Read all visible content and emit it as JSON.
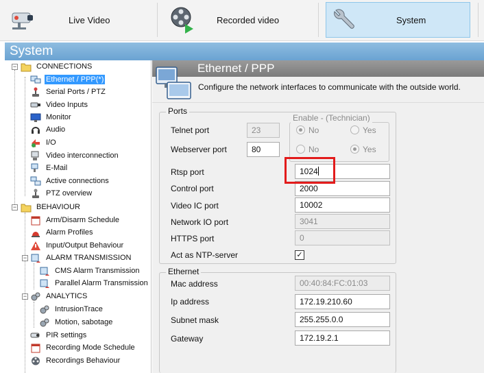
{
  "topbar": {
    "tabs": [
      {
        "label": "Live Video",
        "icon": "security-camera-icon",
        "selected": false
      },
      {
        "label": "Recorded video",
        "icon": "film-reel-play-icon",
        "selected": false
      },
      {
        "label": "System",
        "icon": "wrench-icon",
        "selected": true
      }
    ]
  },
  "system_title": "System",
  "tree": {
    "connections": {
      "label": "CONNECTIONS",
      "items": [
        {
          "label": "Ethernet / PPP(*)",
          "icon": "network-computer-icon",
          "selected": true
        },
        {
          "label": "Serial Ports / PTZ",
          "icon": "joystick-icon"
        },
        {
          "label": "Video Inputs",
          "icon": "camera-icon"
        },
        {
          "label": "Monitor",
          "icon": "monitor-icon"
        },
        {
          "label": "Audio",
          "icon": "headset-icon"
        },
        {
          "label": "I/O",
          "icon": "io-icon"
        },
        {
          "label": "Video interconnection",
          "icon": "video-link-icon"
        },
        {
          "label": "E-Mail",
          "icon": "email-icon"
        },
        {
          "label": "Active connections",
          "icon": "connections-icon"
        },
        {
          "label": "PTZ overview",
          "icon": "joystick-icon"
        }
      ]
    },
    "behaviour": {
      "label": "BEHAVIOUR",
      "items": [
        {
          "label": "Arm/Disarm Schedule",
          "icon": "calendar-icon"
        },
        {
          "label": "Alarm Profiles",
          "icon": "alarm-icon"
        },
        {
          "label": "Input/Output Behaviour",
          "icon": "warning-icon"
        }
      ],
      "alarm_transmission": {
        "label": "ALARM TRANSMISSION",
        "items": [
          {
            "label": "CMS Alarm Transmission",
            "icon": "alarm-tx-icon"
          },
          {
            "label": "Parallel Alarm Transmission",
            "icon": "alarm-tx-icon"
          }
        ]
      },
      "analytics": {
        "label": "ANALYTICS",
        "items": [
          {
            "label": "IntrusionTrace",
            "icon": "gears-icon"
          },
          {
            "label": "Motion, sabotage",
            "icon": "gears-icon"
          }
        ]
      },
      "more_items": [
        {
          "label": "PIR settings",
          "icon": "pir-sensor-icon"
        },
        {
          "label": "Recording Mode Schedule",
          "icon": "calendar-icon"
        },
        {
          "label": "Recordings Behaviour",
          "icon": "film-reel-icon"
        }
      ]
    }
  },
  "page": {
    "title": "Ethernet / PPP",
    "description": "Configure the network interfaces to communicate with the outside world."
  },
  "ports": {
    "group_label": "Ports",
    "enable_label": "Enable - (Technician)",
    "no_label": "No",
    "yes_label": "Yes",
    "telnet": {
      "label": "Telnet port",
      "value": "23",
      "enabled": false
    },
    "webserver": {
      "label": "Webserver port",
      "value": "80",
      "enabled": true
    },
    "rtsp": {
      "label": "Rtsp port",
      "value": "1024"
    },
    "control": {
      "label": "Control port",
      "value": "2000"
    },
    "video_ic": {
      "label": "Video IC port",
      "value": "10002"
    },
    "network_io": {
      "label": "Network IO port",
      "value": "3041"
    },
    "https": {
      "label": "HTTPS port",
      "value": "0"
    },
    "ntp": {
      "label": "Act as NTP-server",
      "checked": true
    }
  },
  "ethernet": {
    "group_label": "Ethernet",
    "mac": {
      "label": "Mac address",
      "value": "00:40:84:FC:01:03"
    },
    "ip": {
      "label": "Ip address",
      "value": "172.19.210.60"
    },
    "subnet": {
      "label": "Subnet mask",
      "value": "255.255.0.0"
    },
    "gateway": {
      "label": "Gateway",
      "value": "172.19.2.1"
    }
  },
  "colors": {
    "highlight": "#e21b1b",
    "selection": "#3399ff",
    "header": "#7b9fc7"
  }
}
